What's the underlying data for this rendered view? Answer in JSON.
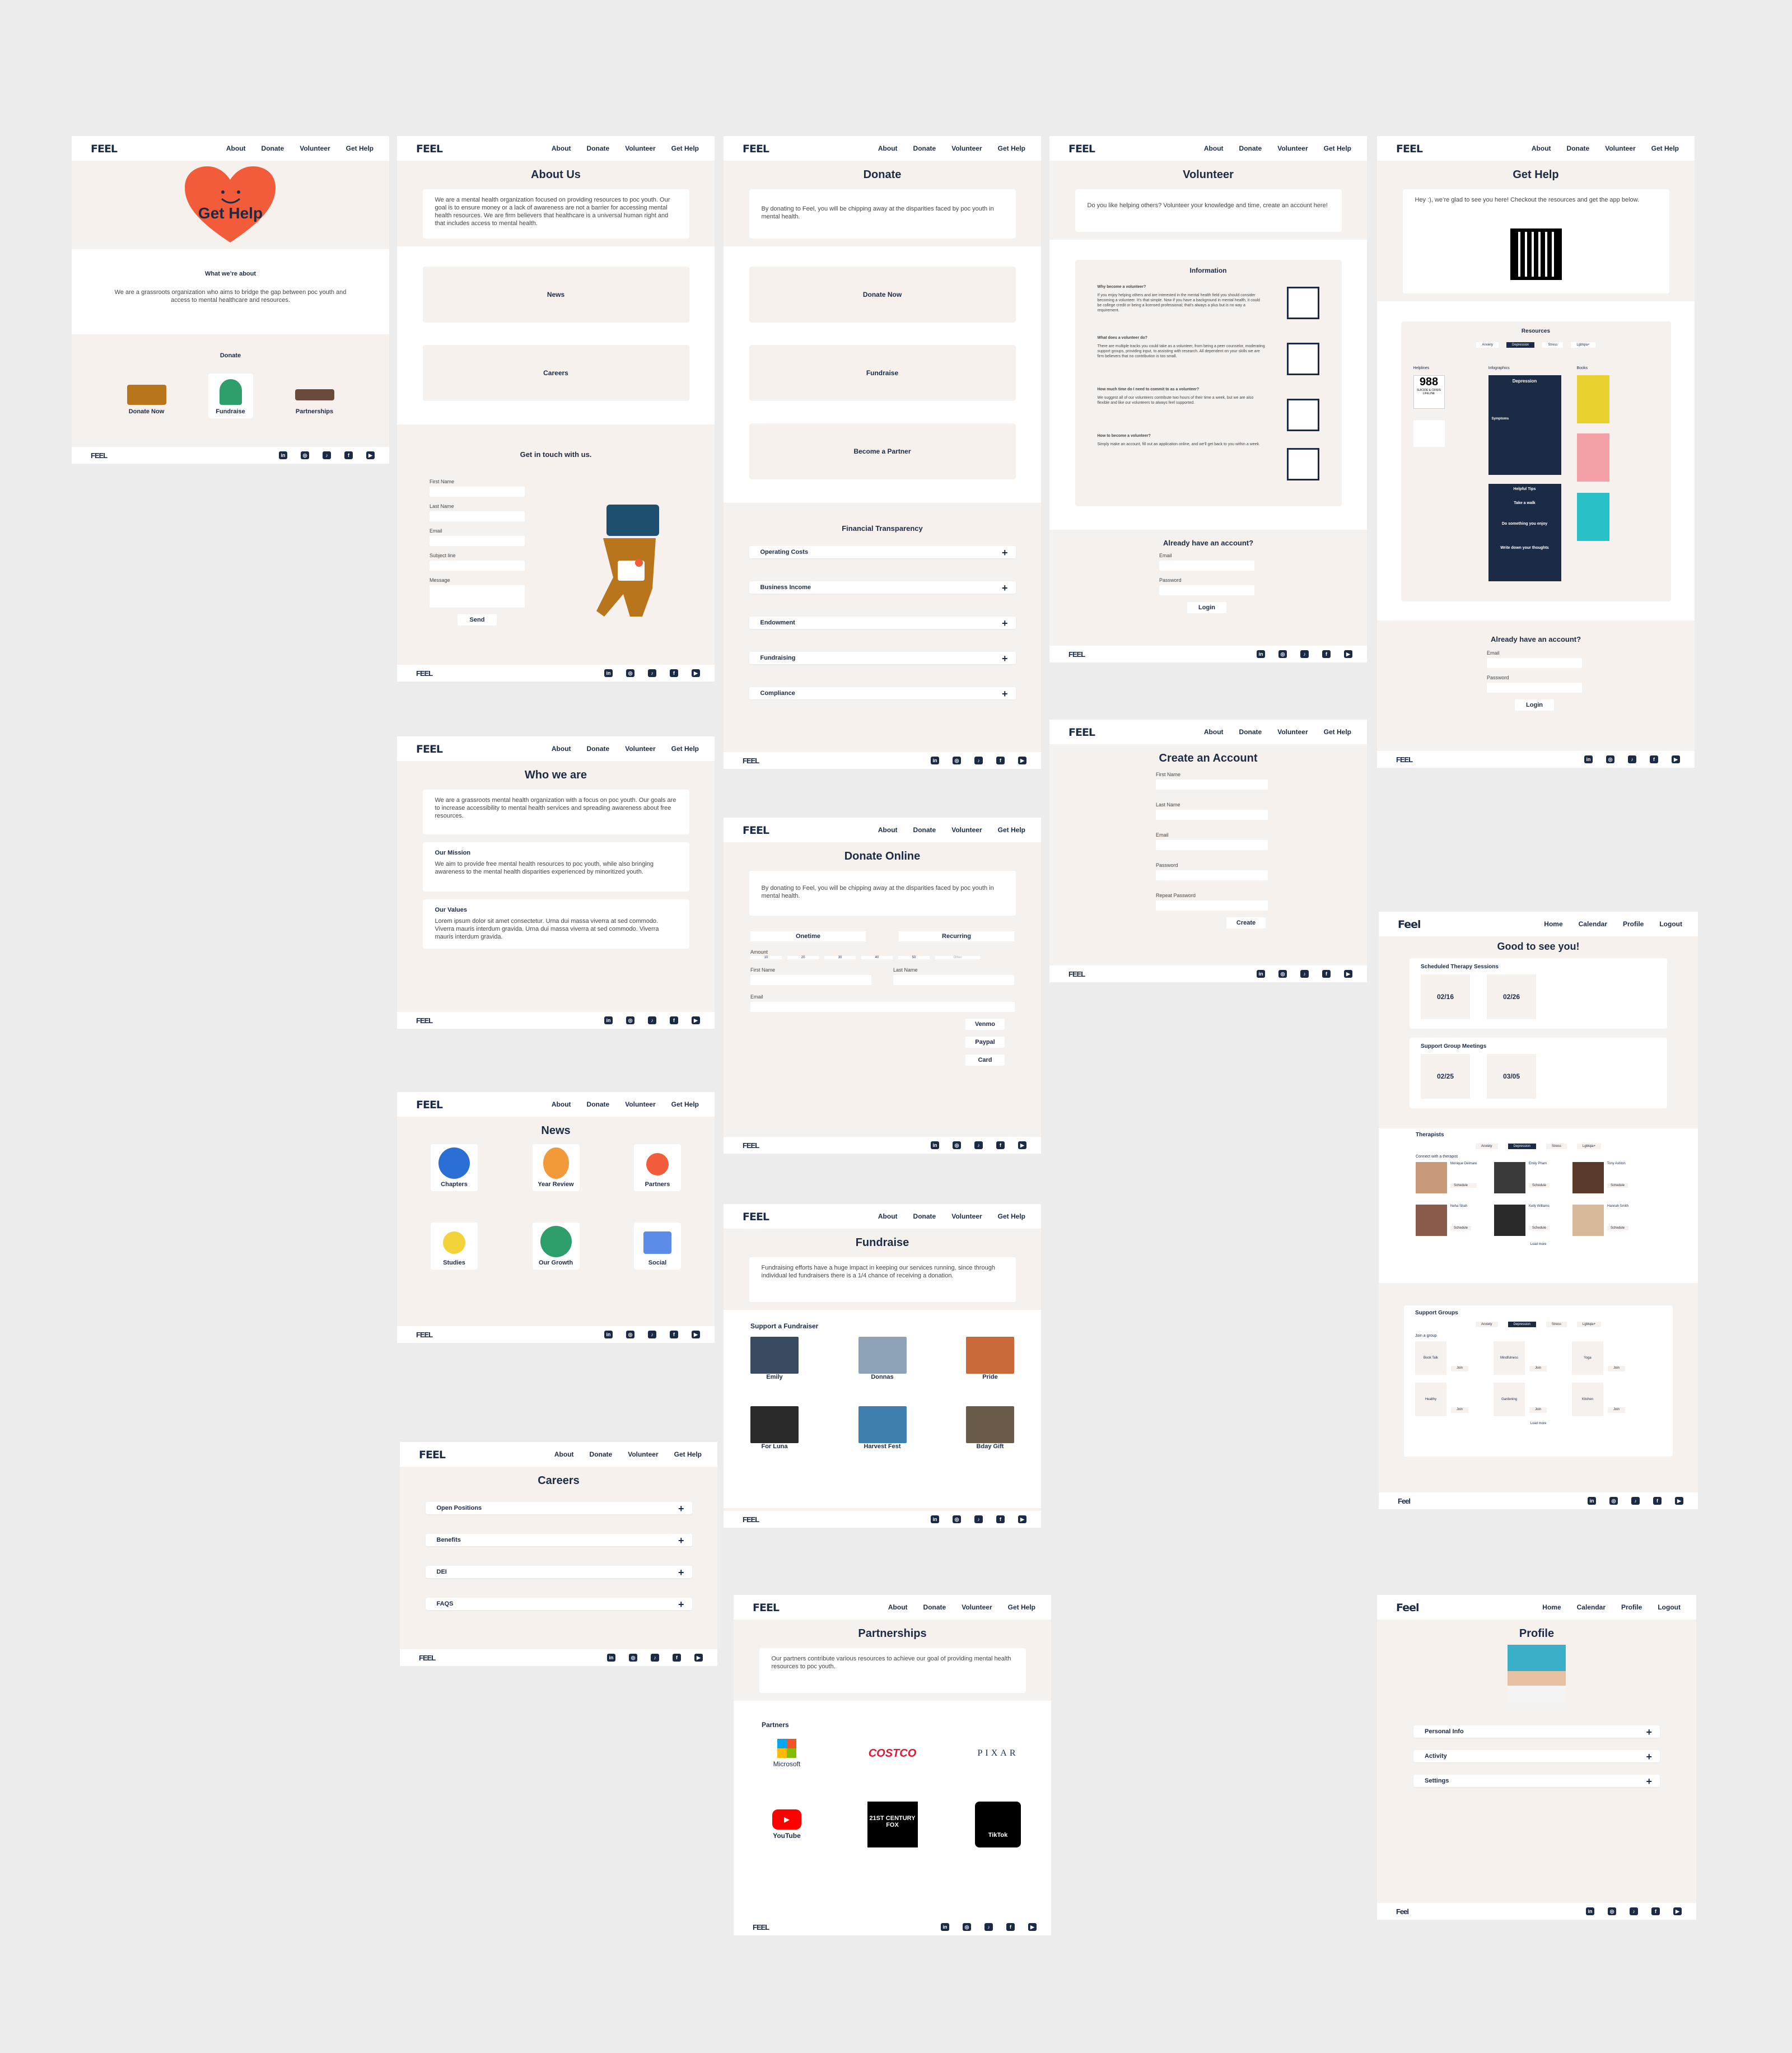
{
  "nav": {
    "about": "About",
    "donate": "Donate",
    "volunteer": "Volunteer",
    "get_help": "Get Help"
  },
  "app_nav": {
    "home": "Home",
    "calendar": "Calendar",
    "profile": "Profile",
    "logout": "Logout"
  },
  "brand": {
    "logo": "FEEL",
    "logo_app": "Feel"
  },
  "colors": {
    "bg": "#ececec",
    "panel": "#f6f1ed",
    "navy": "#1c2b45",
    "heart": "#f25c3b"
  },
  "home": {
    "hero": "Get Help",
    "about_heading": "What we’re about",
    "about_text": "We are a grassroots organization who aims to bridge the gap between poc youth and access to mental healthcare and resources.",
    "donate_heading": "Donate",
    "items": [
      "Donate Now",
      "Fundraise",
      "Partnerships"
    ]
  },
  "about": {
    "title": "About Us",
    "text": "We are a mental health organization focused on providing resources to poc youth. Our goal is to ensure money or a lack of awareness are not a barrier for accessing mental health resources. We are firm believers that healthcare is a universal human right and that includes access to mental health.",
    "buttons": [
      "News",
      "Careers"
    ],
    "contact_heading": "Get in touch with us.",
    "fields": [
      "First Name",
      "Last Name",
      "Email",
      "Subject line",
      "Message"
    ],
    "send": "Send"
  },
  "donate": {
    "title": "Donate",
    "text": "By donating to Feel, you will be chipping away at the disparities faced by poc youth in mental health.",
    "buttons": [
      "Donate Now",
      "Fundraise",
      "Become a Partner"
    ],
    "transparency_heading": "Financial Transparency",
    "items": [
      "Operating Costs",
      "Business Income",
      "Endowment",
      "Fundraising",
      "Compliance"
    ]
  },
  "volunteer": {
    "title": "Volunteer",
    "text": "Do you like helping others? Volunteer your knowledge and time, create an account here!",
    "info_heading": "Information",
    "qa": [
      {
        "q": "Why become a volunteer?",
        "a": "If you enjoy helping others and are interested in the mental health field you should consider becoming a volunteer. It's that simple. Now if you have a background in mental health, it could be college credit or being a licensed professional; that's always a plus but is no way a requirement."
      },
      {
        "q": "What does a volunteer do?",
        "a": "There are multiple tracks you could take as a volunteer, from being a peer counselor, moderating support groups, providing input, to assisting with research. All dependent on your skills we are firm believers that no contribution is too small."
      },
      {
        "q": "How much time  do I need to commit to as a volunteer?",
        "a": "We suggest all of our volunteers contribute two  hours of their time a week, but we are also flexible and like our volunteers to always feel supported."
      },
      {
        "q": "How to become a volunteer?",
        "a": "Simply make an account, fill out an application online, and we'll get back to you within a week."
      }
    ],
    "account_heading": "Already have an account?",
    "email": "Email",
    "password": "Password",
    "login": "Login"
  },
  "gethelp": {
    "title": "Get Help",
    "text": "Hey :), we’re glad to see you here! Checkout the resources and get the app below.",
    "resources_heading": "Resources",
    "tabs": [
      "Anxiety",
      "Depression",
      "Stress",
      "Lgbtqia+"
    ],
    "cols": [
      "Helplines",
      "Infographics",
      "Books"
    ],
    "helpline_988": "988",
    "lifeline": "SUICIDE & CRISIS LIFELINE",
    "depression": "Depression",
    "symptoms": "Symptoms",
    "helpful_tips": "Helpful Tips",
    "tip1": "Take a walk",
    "tip2": "Do something you enjoy",
    "tip3": "Write down your thoughts",
    "account_heading": "Already have an account?",
    "email": "Email",
    "password": "Password",
    "login": "Login"
  },
  "create": {
    "title": "Create an Account",
    "fields": [
      "First Name",
      "Last Name",
      "Email",
      "Password",
      "Repeat Password"
    ],
    "button": "Create"
  },
  "who": {
    "title": "Who we are",
    "intro": "We are a grassroots mental health organization with a focus on poc youth. Our goals are to increase accessibility to mental health services and spreading awareness about free resources.",
    "mission_heading": "Our Mission",
    "mission": "We aim to provide free mental health resources to poc youth, while also bringing awareness to the mental health disparities experienced by minoritized youth.",
    "values_heading": "Our Values",
    "values": "Lorem ipsum dolor sit amet consectetur. Urna dui massa viverra at sed commodo. Viverra mauris interdum gravida. Urna dui massa viverra at sed commodo. Viverra mauris interdum gravida."
  },
  "news": {
    "title": "News",
    "tiles": [
      "Chapters",
      "Year Review",
      "Partners",
      "Studies",
      "Our Growth",
      "Social"
    ]
  },
  "careers": {
    "title": "Careers",
    "items": [
      "Open Positions",
      "Benefits",
      "DEI",
      "FAQS"
    ]
  },
  "donate_online": {
    "title": "Donate Online",
    "text": "By donating to Feel, you will be chipping away at the disparities faced by poc youth in mental health.",
    "onetime": "Onetime",
    "recurring": "Recurring",
    "amount": "Amount",
    "amounts": [
      "10",
      "20",
      "30",
      "40",
      "50"
    ],
    "other": "Other",
    "first": "First Name",
    "last": "Last Name",
    "email": "Email",
    "methods": [
      "Venmo",
      "Paypal",
      "Card"
    ]
  },
  "fundraise": {
    "title": "Fundraise",
    "text": "Fundraising efforts have a huge impact in keeping our services running, since through individual led fundraisers there is a 1/4 chance of receiving a donation.",
    "support_heading": "Support a Fundraiser",
    "people": [
      "Emily",
      "Donnas",
      "Pride",
      "For Luna",
      "Harvest Fest",
      "Bday Gift"
    ]
  },
  "partnerships": {
    "title": "Partnerships",
    "text": "Our partners contribute various resources to achieve our goal of providing mental health resources to poc youth.",
    "partners_heading": "Partners",
    "logos": [
      "Microsoft",
      "COSTCO",
      "PIXAR",
      "YouTube",
      "21ST CENTURY FOX",
      "TikTok"
    ]
  },
  "dashboard": {
    "greeting": "Good to see you!",
    "therapy_heading": "Scheduled Therapy Sessions",
    "therapy_dates": [
      "02/16",
      "02/26"
    ],
    "support_heading": "Support Group Meetings",
    "support_dates": [
      "02/25",
      "03/05"
    ],
    "therapists_heading": "Therapists",
    "tabs": [
      "Anxiety",
      "Depression",
      "Stress",
      "Lgbtqia+"
    ],
    "connect": "Connect with a therapist",
    "therapists": [
      "Monique Delmare",
      "Emily Pham",
      "Tony Ashton",
      "Neha Shah",
      "Kelly Williams",
      "Hannah Smith"
    ],
    "schedule": "Schedule",
    "load_more": "Load more",
    "groups_heading": "Support Groups",
    "join_heading": "Join a group",
    "groups": [
      "Book Talk",
      "Mindfulness",
      "Yoga",
      "Healthy",
      "Gardening",
      "Kitchen"
    ],
    "join": "Join"
  },
  "profile": {
    "title": "Profile",
    "items": [
      "Personal Info",
      "Activity",
      "Settings"
    ]
  }
}
